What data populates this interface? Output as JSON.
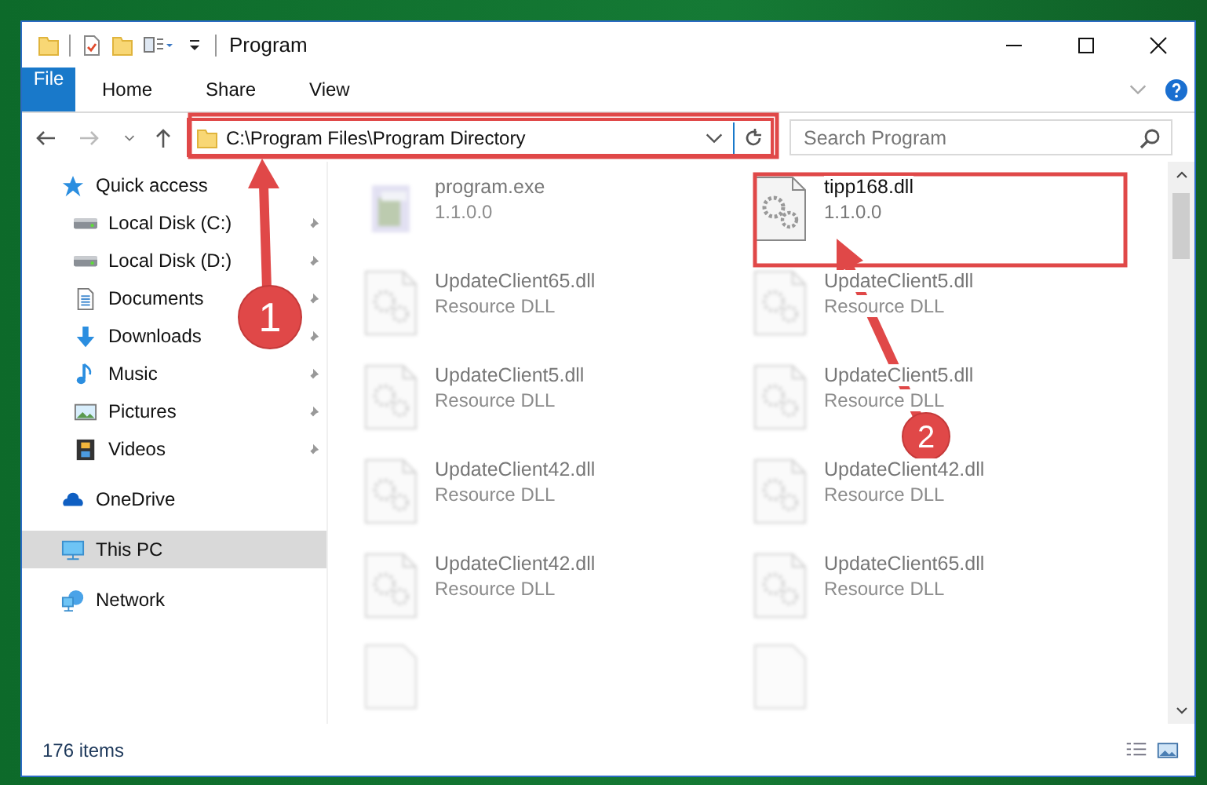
{
  "window": {
    "title": "Program"
  },
  "ribbon_tabs": [
    {
      "label": "File",
      "kind": "file"
    },
    {
      "label": "Home",
      "kind": "tab"
    },
    {
      "label": "Share",
      "kind": "tab"
    },
    {
      "label": "View",
      "kind": "tab"
    }
  ],
  "address_bar": {
    "path": "C:\\Program Files\\Program Directory",
    "highlighted": true
  },
  "search": {
    "placeholder": "Search Program"
  },
  "sidebar": {
    "items": [
      {
        "label": "Quick access",
        "kind": "star",
        "selected": false,
        "children": [
          {
            "label": "Local Disk (C:)",
            "kind": "drive",
            "pinned": true
          },
          {
            "label": "Local Disk (D:)",
            "kind": "drive",
            "pinned": true
          },
          {
            "label": "Documents",
            "kind": "document",
            "pinned": true
          },
          {
            "label": "Downloads",
            "kind": "download",
            "pinned": true
          },
          {
            "label": "Music",
            "kind": "music",
            "pinned": true
          },
          {
            "label": "Pictures",
            "kind": "picture",
            "pinned": true
          },
          {
            "label": "Videos",
            "kind": "video",
            "pinned": true
          }
        ]
      },
      {
        "label": "OneDrive",
        "kind": "cloud",
        "selected": false
      },
      {
        "label": "This PC",
        "kind": "computer",
        "selected": true
      },
      {
        "label": "Network",
        "kind": "network",
        "selected": false
      }
    ]
  },
  "files": [
    {
      "name": "program.exe",
      "detail": "1.1.0.0",
      "kind": "exe",
      "blurred": true,
      "highlighted": false
    },
    {
      "name": "tipp168.dll",
      "detail": "1.1.0.0",
      "kind": "dll",
      "blurred": false,
      "highlighted": true
    },
    {
      "name": "UpdateClient65.dll",
      "detail": "Resource DLL",
      "kind": "dll",
      "blurred": true,
      "highlighted": false
    },
    {
      "name": "UpdateClient5.dll",
      "detail": "Resource DLL",
      "kind": "dll",
      "blurred": true,
      "highlighted": false
    },
    {
      "name": "UpdateClient5.dll",
      "detail": "Resource DLL",
      "kind": "dll",
      "blurred": true,
      "highlighted": false
    },
    {
      "name": "UpdateClient5.dll",
      "detail": "Resource DLL",
      "kind": "dll",
      "blurred": true,
      "highlighted": false
    },
    {
      "name": "UpdateClient42.dll",
      "detail": "Resource DLL",
      "kind": "dll",
      "blurred": true,
      "highlighted": false
    },
    {
      "name": "UpdateClient42.dll",
      "detail": "Resource DLL",
      "kind": "dll",
      "blurred": true,
      "highlighted": false
    },
    {
      "name": "UpdateClient42.dll",
      "detail": "Resource DLL",
      "kind": "dll",
      "blurred": true,
      "highlighted": false
    },
    {
      "name": "UpdateClient65.dll",
      "detail": "Resource DLL",
      "kind": "dll",
      "blurred": true,
      "highlighted": false
    }
  ],
  "status_bar": {
    "count": "176 items"
  },
  "annotations": [
    {
      "label": "1"
    },
    {
      "label": "2"
    }
  ]
}
